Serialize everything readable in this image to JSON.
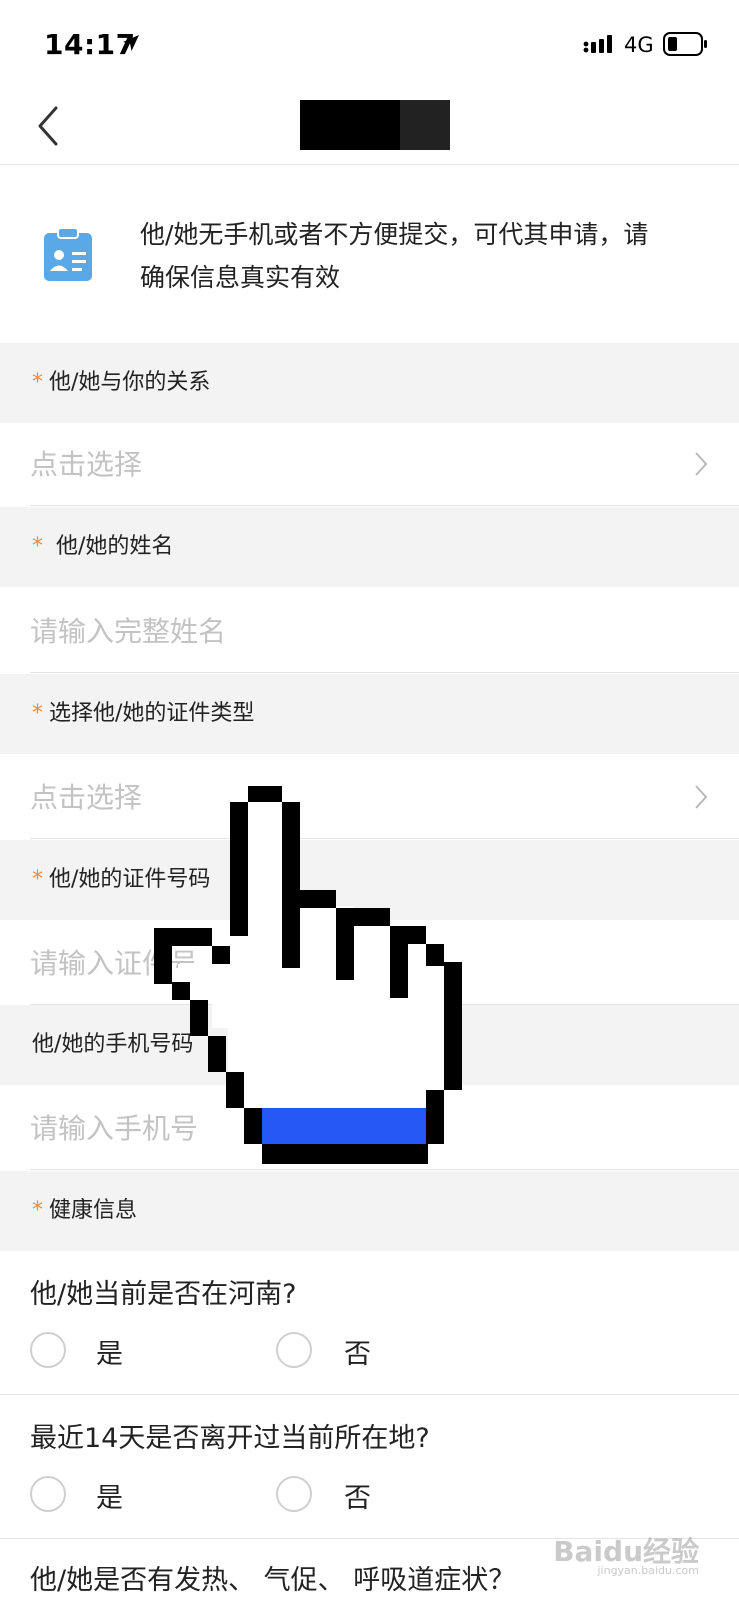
{
  "status": {
    "time": "14:17",
    "network": "4G"
  },
  "intro": {
    "text": "他/她无手机或者不方便提交，可代其申请，请确保信息真实有效"
  },
  "fields": [
    {
      "label": "他/她与你的关系",
      "required": true,
      "placeholder": "点击选择",
      "type": "select"
    },
    {
      "label": "他/她的姓名",
      "required": true,
      "placeholder": "请输入完整姓名",
      "type": "input"
    },
    {
      "label": "选择他/她的证件类型",
      "required": true,
      "placeholder": "点击选择",
      "type": "select"
    },
    {
      "label": "他/她的证件号码",
      "required": true,
      "placeholder": "请输入证件号码",
      "type": "input"
    },
    {
      "label": "他/她的手机号码",
      "required": false,
      "placeholder": "请输入手机号",
      "type": "input"
    }
  ],
  "required_mark": "*",
  "health": {
    "label": "健康信息",
    "questions": [
      {
        "text": "他/她当前是否在河南?",
        "options": [
          "是",
          "否"
        ]
      },
      {
        "text": "最近14天是否离开过当前所在地?",
        "options": [
          "是",
          "否"
        ]
      },
      {
        "text": "他/她是否有发热、 气促、 呼吸道症状？"
      }
    ]
  },
  "watermark": {
    "text": "Baidu经验",
    "sub": "jingyan.baidu.com"
  },
  "colors": {
    "required": "#f08a3c",
    "placeholder": "#c3c3c3",
    "section_bg": "#f3f3f3",
    "icon": "#5aa9e6",
    "cursor_accent": "#2658f5"
  }
}
